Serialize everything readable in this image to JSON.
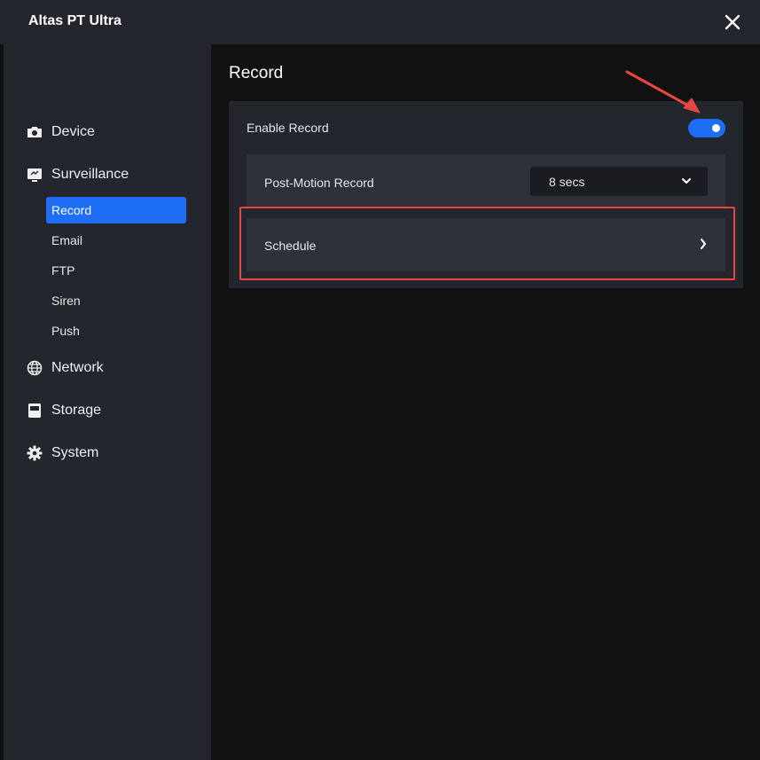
{
  "window": {
    "title": "Altas PT Ultra"
  },
  "sidebar": {
    "items": [
      {
        "label": "Device",
        "icon": "camera-icon"
      },
      {
        "label": "Surveillance",
        "icon": "monitor-icon"
      },
      {
        "label": "Network",
        "icon": "globe-icon"
      },
      {
        "label": "Storage",
        "icon": "storage-icon"
      },
      {
        "label": "System",
        "icon": "gear-icon"
      }
    ],
    "surveillance_sub": [
      {
        "label": "Record",
        "active": true
      },
      {
        "label": "Email"
      },
      {
        "label": "FTP"
      },
      {
        "label": "Siren"
      },
      {
        "label": "Push"
      }
    ]
  },
  "main": {
    "title": "Record",
    "enable_record": {
      "label": "Enable Record",
      "enabled": true
    },
    "post_motion": {
      "label": "Post-Motion Record",
      "value": "8 secs"
    },
    "schedule": {
      "label": "Schedule"
    }
  },
  "colors": {
    "accent": "#1e6ef5",
    "annotation": "#e8473f",
    "sidebar_bg": "#23262d",
    "content_bg": "#111111"
  }
}
